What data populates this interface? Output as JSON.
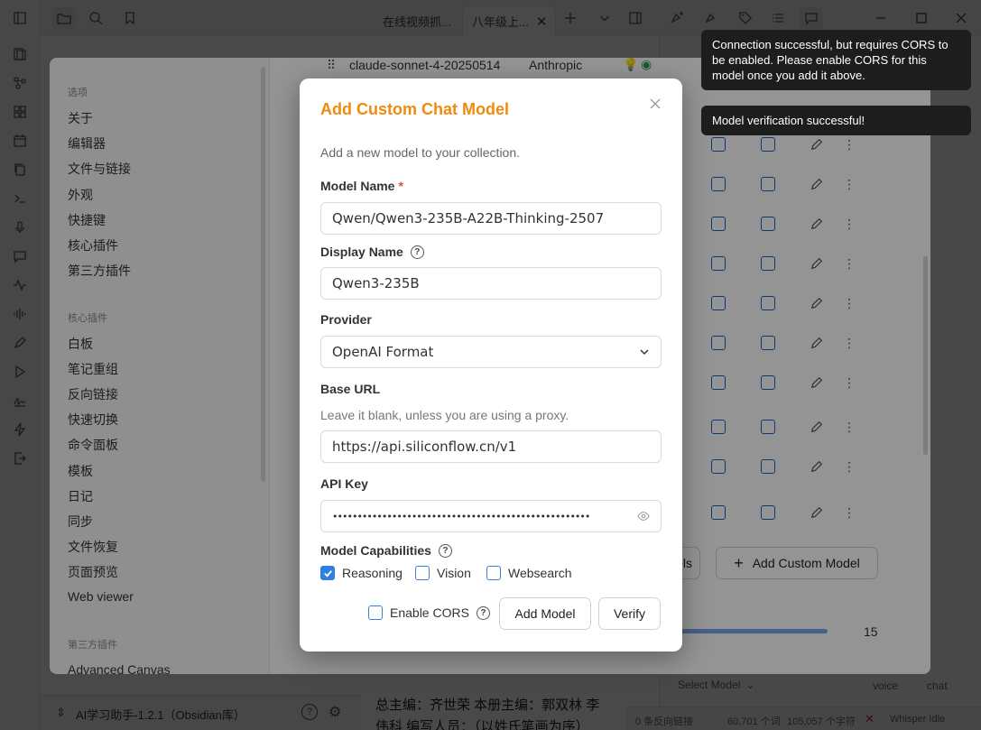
{
  "topbar": {
    "tabs": [
      "在线视频抓...",
      "八年级上..."
    ]
  },
  "editor": {
    "line1": "总主编：齐世荣  本册主编：郭双林  李",
    "line2": "伟科  编写人员：（以姓氏笔画为序）"
  },
  "vault": {
    "name": "AI学习助手-1.2.1（Obsidian库）"
  },
  "statusbar": {
    "backlinks": "0 条反向链接",
    "words": "60,701 个词",
    "chars": "105,057 个字符",
    "whisper": "Whisper Idle"
  },
  "chat": {
    "select_model": "Select Model",
    "voice": "voice",
    "chat": "chat"
  },
  "settings": {
    "nav": {
      "options_header": "选项",
      "options": [
        "关于",
        "编辑器",
        "文件与链接",
        "外观",
        "快捷键",
        "核心插件",
        "第三方插件"
      ],
      "core_header": "核心插件",
      "core": [
        "白板",
        "笔记重组",
        "反向链接",
        "快速切换",
        "命令面板",
        "模板",
        "日记",
        "同步",
        "文件恢复",
        "页面预览",
        "Web viewer"
      ],
      "third_header": "第三方插件",
      "third": [
        "Advanced Canvas"
      ]
    },
    "model_row": {
      "name": "claude-sonnet-4-20250514",
      "provider": "Anthropic"
    },
    "add_custom_model_label": "Add Custom Model",
    "partial_button_label": "els",
    "slider_value": "15"
  },
  "modal": {
    "title": "Add Custom Chat Model",
    "description": "Add a new model to your collection.",
    "model_name_label": "Model Name",
    "model_name_required": "*",
    "model_name_value": "Qwen/Qwen3-235B-A22B-Thinking-2507",
    "display_name_label": "Display Name",
    "display_name_value": "Qwen3-235B",
    "provider_label": "Provider",
    "provider_value": "OpenAI Format",
    "base_url_label": "Base URL",
    "base_url_hint": "Leave it blank, unless you are using a proxy.",
    "base_url_value": "https://api.siliconflow.cn/v1",
    "api_key_label": "API Key",
    "api_key_value": "••••••••••••••••••••••••••••••••••••••••••••••••••••",
    "capabilities_label": "Model Capabilities",
    "capabilities": [
      {
        "label": "Reasoning",
        "checked": true
      },
      {
        "label": "Vision",
        "checked": false
      },
      {
        "label": "Websearch",
        "checked": false
      }
    ],
    "enable_cors_label": "Enable CORS",
    "add_model_button": "Add Model",
    "verify_button": "Verify"
  },
  "toasts": [
    "Connection successful, but requires CORS to be enabled. Please enable CORS for this model once you add it above.",
    "Model verification successful!"
  ],
  "colors": {
    "accent": "#f08a0c",
    "checkbox": "#2f7fe0",
    "required": "#e5484d",
    "toast_bg": "#1d1d1d"
  }
}
